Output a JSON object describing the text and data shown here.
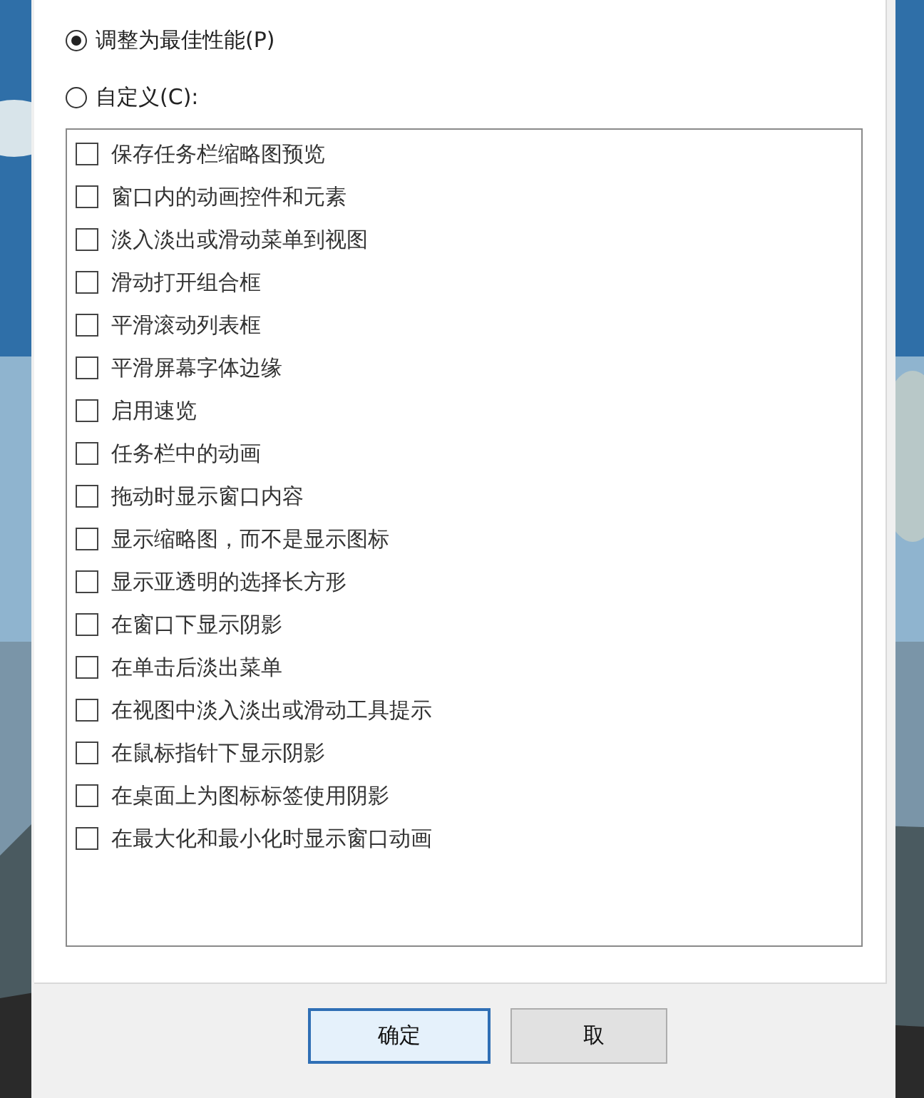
{
  "options": [
    {
      "label": "调整为最佳性能(P)",
      "selected": true
    },
    {
      "label": "自定义(C):",
      "selected": false
    }
  ],
  "effects": [
    {
      "label": "保存任务栏缩略图预览",
      "checked": false
    },
    {
      "label": "窗口内的动画控件和元素",
      "checked": false
    },
    {
      "label": "淡入淡出或滑动菜单到视图",
      "checked": false
    },
    {
      "label": "滑动打开组合框",
      "checked": false
    },
    {
      "label": "平滑滚动列表框",
      "checked": false
    },
    {
      "label": "平滑屏幕字体边缘",
      "checked": false
    },
    {
      "label": "启用速览",
      "checked": false
    },
    {
      "label": "任务栏中的动画",
      "checked": false
    },
    {
      "label": "拖动时显示窗口内容",
      "checked": false
    },
    {
      "label": "显示缩略图，而不是显示图标",
      "checked": false
    },
    {
      "label": "显示亚透明的选择长方形",
      "checked": false
    },
    {
      "label": "在窗口下显示阴影",
      "checked": false
    },
    {
      "label": "在单击后淡出菜单",
      "checked": false
    },
    {
      "label": "在视图中淡入淡出或滑动工具提示",
      "checked": false
    },
    {
      "label": "在鼠标指针下显示阴影",
      "checked": false
    },
    {
      "label": "在桌面上为图标标签使用阴影",
      "checked": false
    },
    {
      "label": "在最大化和最小化时显示窗口动画",
      "checked": false
    }
  ],
  "buttons": [
    {
      "label": "确定",
      "kind": "default"
    },
    {
      "label": "取",
      "kind": "normal"
    }
  ]
}
